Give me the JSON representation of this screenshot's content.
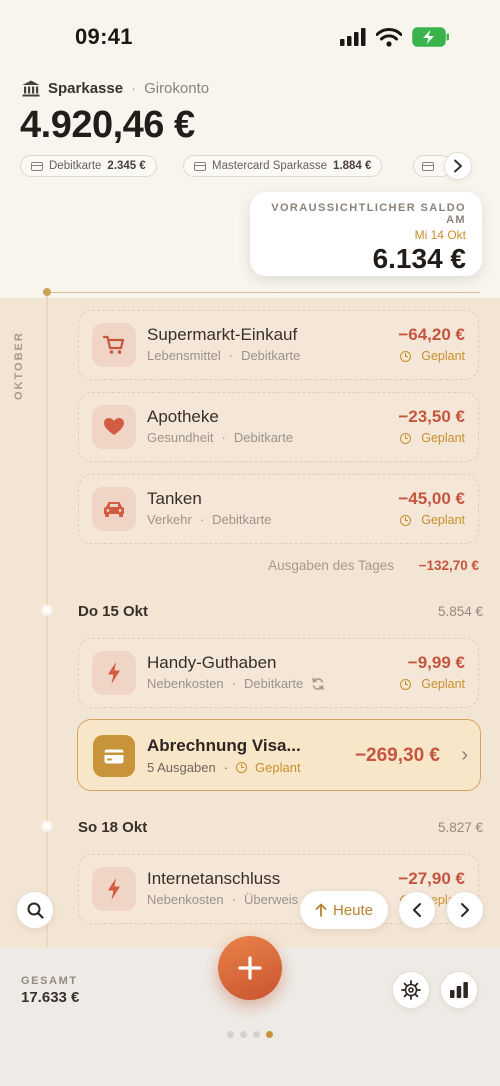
{
  "status": {
    "time": "09:41"
  },
  "account": {
    "bank": "Sparkasse",
    "separator": "·",
    "type": "Girokonto",
    "balance": "4.920,46 €"
  },
  "chips": [
    {
      "label": "Debitkarte",
      "value": "2.345 €"
    },
    {
      "label": "Mastercard Sparkasse",
      "value": "1.884 €"
    }
  ],
  "forecast": {
    "label": "VORAUSSICHTLICHER SALDO AM",
    "date": "Mi 14 Okt",
    "value": "6.134 €"
  },
  "timeline": {
    "month": "OKTOBER"
  },
  "transactions": [
    {
      "title": "Supermarkt-Einkauf",
      "category": "Lebensmittel",
      "method": "Debitkarte",
      "amount": "−64,20 €",
      "status": "Geplant",
      "icon": "cart-icon"
    },
    {
      "title": "Apotheke",
      "category": "Gesundheit",
      "method": "Debitkarte",
      "amount": "−23,50 €",
      "status": "Geplant",
      "icon": "heart-icon"
    },
    {
      "title": "Tanken",
      "category": "Verkehr",
      "method": "Debitkarte",
      "amount": "−45,00 €",
      "status": "Geplant",
      "icon": "car-icon"
    }
  ],
  "day_total": {
    "label": "Ausgaben des Tages",
    "value": "−132,70 €"
  },
  "days": [
    {
      "label": "Do 15 Okt",
      "balance": "5.854 €"
    },
    {
      "label": "So 18 Okt",
      "balance": "5.827 €"
    }
  ],
  "handy": {
    "title": "Handy-Guthaben",
    "category": "Nebenkosten",
    "method": "Debitkarte",
    "amount": "−9,99 €",
    "status": "Geplant"
  },
  "visa": {
    "title": "Abrechnung Visa...",
    "count": "5 Ausgaben",
    "status": "Geplant",
    "amount": "−269,30 €"
  },
  "internet": {
    "title": "Internetanschluss",
    "category": "Nebenkosten",
    "method": "Überweis",
    "amount": "−27,90 €",
    "status": "Geplant"
  },
  "controls": {
    "today": "Heute"
  },
  "footer": {
    "total_label": "GESAMT",
    "total_value": "17.633 €"
  },
  "colors": {
    "accent": "#c7943b",
    "expense": "#c5553e",
    "fab": "#e07a45"
  }
}
